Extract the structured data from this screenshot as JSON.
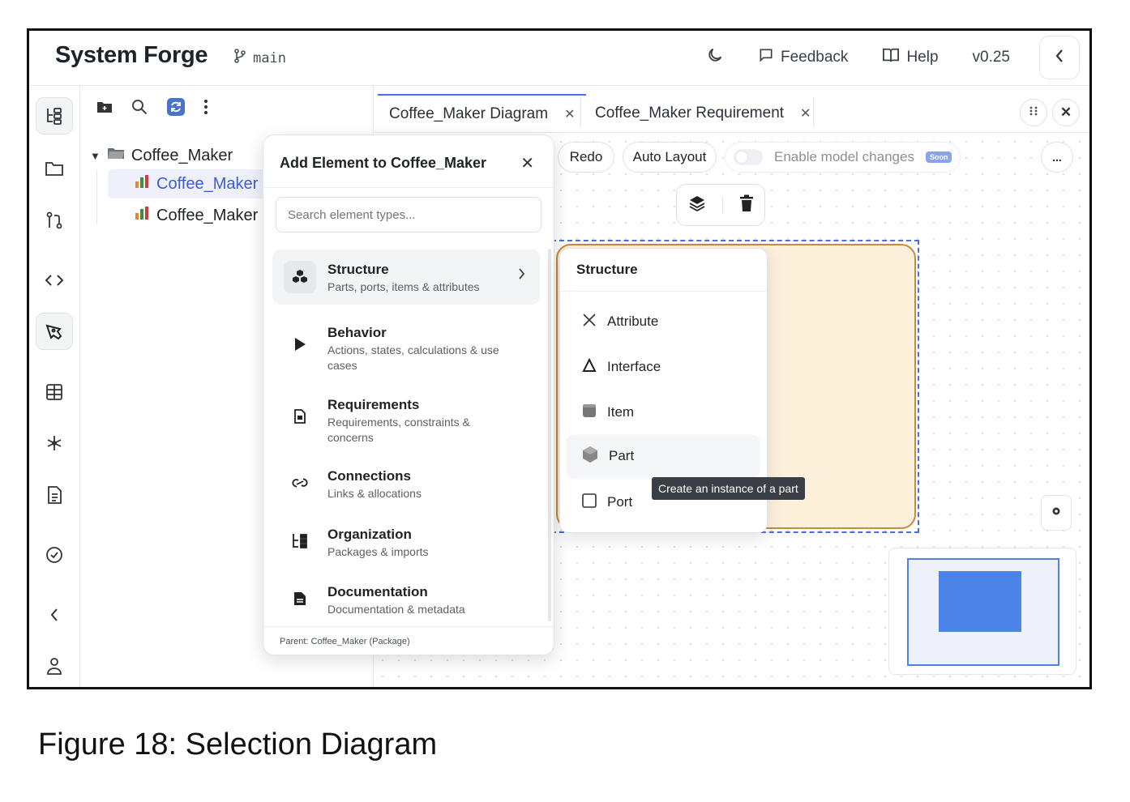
{
  "app": {
    "title": "System Forge",
    "branch": "main"
  },
  "topbar": {
    "feedback": "Feedback",
    "help": "Help",
    "version": "v0.25"
  },
  "explorer": {
    "tree": [
      {
        "label": "Coffee_Maker",
        "kind": "package",
        "expanded": true
      },
      {
        "label": "Coffee_Maker",
        "kind": "diagram",
        "selected": true
      },
      {
        "label": "Coffee_Maker",
        "kind": "diagram",
        "selected": false
      }
    ]
  },
  "tabs": [
    {
      "label": "Coffee_Maker Diagram",
      "active": true
    },
    {
      "label": "Coffee_Maker Requirement",
      "active": false
    }
  ],
  "canvas_toolbar": {
    "redo": "Redo",
    "auto_layout": "Auto Layout",
    "enable_model_changes": "Enable model changes",
    "soon_badge": "Soon",
    "more": "..."
  },
  "add_element": {
    "title": "Add Element to Coffee_Maker",
    "search_placeholder": "Search element types...",
    "categories": [
      {
        "title": "Structure",
        "desc": "Parts, ports, items & attributes",
        "icon": "cubes-icon"
      },
      {
        "title": "Behavior",
        "desc": "Actions, states, calculations & use cases",
        "icon": "play-icon"
      },
      {
        "title": "Requirements",
        "desc": "Requirements, constraints & concerns",
        "icon": "clipboard-icon"
      },
      {
        "title": "Connections",
        "desc": "Links & allocations",
        "icon": "link-icon"
      },
      {
        "title": "Organization",
        "desc": "Packages & imports",
        "icon": "hierarchy-icon"
      },
      {
        "title": "Documentation",
        "desc": "Documentation & metadata",
        "icon": "document-icon"
      }
    ],
    "footer": "Parent: Coffee_Maker (Package)"
  },
  "structure_menu": {
    "title": "Structure",
    "items": [
      "Attribute",
      "Interface",
      "Item",
      "Part",
      "Port"
    ],
    "tooltip": "Create an instance of a part"
  },
  "caption": "Figure 18: Selection Diagram",
  "colors": {
    "accent": "#4c6fdd",
    "node_fill": "#fdf0db",
    "node_border": "#c98a3c",
    "minimap_block": "#4c83e6"
  }
}
